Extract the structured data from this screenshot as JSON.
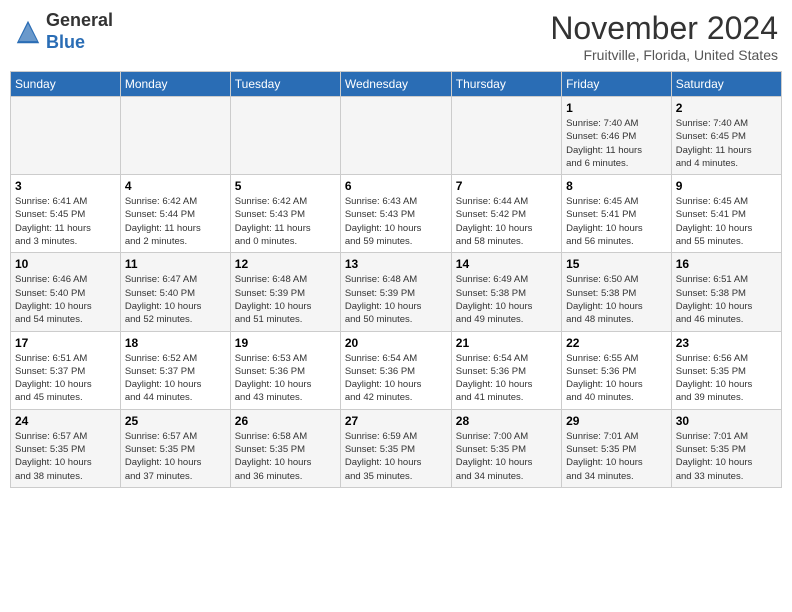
{
  "header": {
    "logo_general": "General",
    "logo_blue": "Blue",
    "month": "November 2024",
    "location": "Fruitville, Florida, United States"
  },
  "weekdays": [
    "Sunday",
    "Monday",
    "Tuesday",
    "Wednesday",
    "Thursday",
    "Friday",
    "Saturday"
  ],
  "weeks": [
    [
      {
        "day": "",
        "info": ""
      },
      {
        "day": "",
        "info": ""
      },
      {
        "day": "",
        "info": ""
      },
      {
        "day": "",
        "info": ""
      },
      {
        "day": "",
        "info": ""
      },
      {
        "day": "1",
        "info": "Sunrise: 7:40 AM\nSunset: 6:46 PM\nDaylight: 11 hours\nand 6 minutes."
      },
      {
        "day": "2",
        "info": "Sunrise: 7:40 AM\nSunset: 6:45 PM\nDaylight: 11 hours\nand 4 minutes."
      }
    ],
    [
      {
        "day": "3",
        "info": "Sunrise: 6:41 AM\nSunset: 5:45 PM\nDaylight: 11 hours\nand 3 minutes."
      },
      {
        "day": "4",
        "info": "Sunrise: 6:42 AM\nSunset: 5:44 PM\nDaylight: 11 hours\nand 2 minutes."
      },
      {
        "day": "5",
        "info": "Sunrise: 6:42 AM\nSunset: 5:43 PM\nDaylight: 11 hours\nand 0 minutes."
      },
      {
        "day": "6",
        "info": "Sunrise: 6:43 AM\nSunset: 5:43 PM\nDaylight: 10 hours\nand 59 minutes."
      },
      {
        "day": "7",
        "info": "Sunrise: 6:44 AM\nSunset: 5:42 PM\nDaylight: 10 hours\nand 58 minutes."
      },
      {
        "day": "8",
        "info": "Sunrise: 6:45 AM\nSunset: 5:41 PM\nDaylight: 10 hours\nand 56 minutes."
      },
      {
        "day": "9",
        "info": "Sunrise: 6:45 AM\nSunset: 5:41 PM\nDaylight: 10 hours\nand 55 minutes."
      }
    ],
    [
      {
        "day": "10",
        "info": "Sunrise: 6:46 AM\nSunset: 5:40 PM\nDaylight: 10 hours\nand 54 minutes."
      },
      {
        "day": "11",
        "info": "Sunrise: 6:47 AM\nSunset: 5:40 PM\nDaylight: 10 hours\nand 52 minutes."
      },
      {
        "day": "12",
        "info": "Sunrise: 6:48 AM\nSunset: 5:39 PM\nDaylight: 10 hours\nand 51 minutes."
      },
      {
        "day": "13",
        "info": "Sunrise: 6:48 AM\nSunset: 5:39 PM\nDaylight: 10 hours\nand 50 minutes."
      },
      {
        "day": "14",
        "info": "Sunrise: 6:49 AM\nSunset: 5:38 PM\nDaylight: 10 hours\nand 49 minutes."
      },
      {
        "day": "15",
        "info": "Sunrise: 6:50 AM\nSunset: 5:38 PM\nDaylight: 10 hours\nand 48 minutes."
      },
      {
        "day": "16",
        "info": "Sunrise: 6:51 AM\nSunset: 5:38 PM\nDaylight: 10 hours\nand 46 minutes."
      }
    ],
    [
      {
        "day": "17",
        "info": "Sunrise: 6:51 AM\nSunset: 5:37 PM\nDaylight: 10 hours\nand 45 minutes."
      },
      {
        "day": "18",
        "info": "Sunrise: 6:52 AM\nSunset: 5:37 PM\nDaylight: 10 hours\nand 44 minutes."
      },
      {
        "day": "19",
        "info": "Sunrise: 6:53 AM\nSunset: 5:36 PM\nDaylight: 10 hours\nand 43 minutes."
      },
      {
        "day": "20",
        "info": "Sunrise: 6:54 AM\nSunset: 5:36 PM\nDaylight: 10 hours\nand 42 minutes."
      },
      {
        "day": "21",
        "info": "Sunrise: 6:54 AM\nSunset: 5:36 PM\nDaylight: 10 hours\nand 41 minutes."
      },
      {
        "day": "22",
        "info": "Sunrise: 6:55 AM\nSunset: 5:36 PM\nDaylight: 10 hours\nand 40 minutes."
      },
      {
        "day": "23",
        "info": "Sunrise: 6:56 AM\nSunset: 5:35 PM\nDaylight: 10 hours\nand 39 minutes."
      }
    ],
    [
      {
        "day": "24",
        "info": "Sunrise: 6:57 AM\nSunset: 5:35 PM\nDaylight: 10 hours\nand 38 minutes."
      },
      {
        "day": "25",
        "info": "Sunrise: 6:57 AM\nSunset: 5:35 PM\nDaylight: 10 hours\nand 37 minutes."
      },
      {
        "day": "26",
        "info": "Sunrise: 6:58 AM\nSunset: 5:35 PM\nDaylight: 10 hours\nand 36 minutes."
      },
      {
        "day": "27",
        "info": "Sunrise: 6:59 AM\nSunset: 5:35 PM\nDaylight: 10 hours\nand 35 minutes."
      },
      {
        "day": "28",
        "info": "Sunrise: 7:00 AM\nSunset: 5:35 PM\nDaylight: 10 hours\nand 34 minutes."
      },
      {
        "day": "29",
        "info": "Sunrise: 7:01 AM\nSunset: 5:35 PM\nDaylight: 10 hours\nand 34 minutes."
      },
      {
        "day": "30",
        "info": "Sunrise: 7:01 AM\nSunset: 5:35 PM\nDaylight: 10 hours\nand 33 minutes."
      }
    ]
  ]
}
